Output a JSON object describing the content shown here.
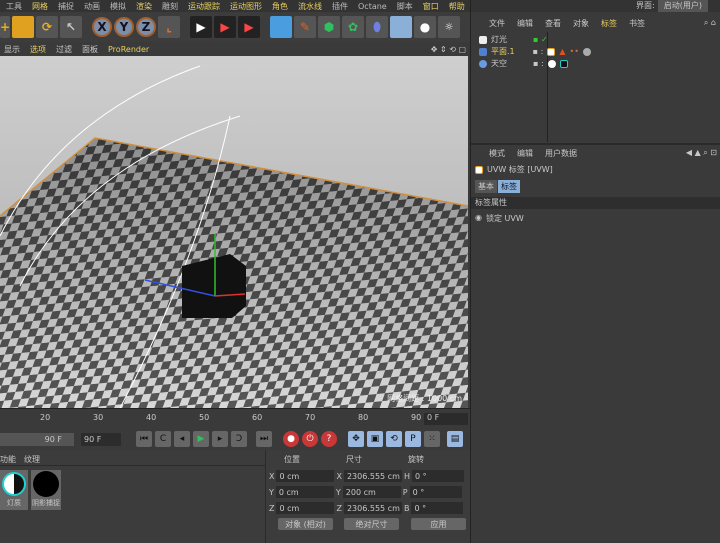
{
  "menu": [
    "工具",
    "网格",
    "捕捉",
    "动画",
    "模拟",
    "渲染",
    "雕刻",
    "运动跟踪",
    "运动图形",
    "角色",
    "流水线",
    "插件",
    "Octane",
    "脚本",
    "窗口",
    "帮助"
  ],
  "toolbar": {
    "x": "X",
    "y": "Y",
    "z": "Z"
  },
  "viewport_menu": [
    "显示",
    "选项",
    "过滤",
    "面板",
    "ProRender"
  ],
  "grid_spacing": "网格间距 : 1000 cm",
  "timeline": {
    "ticks": [
      "20",
      "30",
      "40",
      "50",
      "60",
      "70",
      "80",
      "90"
    ],
    "current_frame": "0 F",
    "range_end": "90 F",
    "end_field": "90 F"
  },
  "materials": {
    "tabs": [
      "功能",
      "纹理"
    ],
    "items": [
      "灯质",
      "阴影捕捉"
    ]
  },
  "coords": {
    "headers": [
      "位置",
      "尺寸",
      "旋转"
    ],
    "rows": [
      {
        "axis": "X",
        "pos": "0 cm",
        "size_axis": "X",
        "size": "2306.555 cm",
        "rot_axis": "H",
        "rot": "0 °"
      },
      {
        "axis": "Y",
        "pos": "0 cm",
        "size_axis": "Y",
        "size": "200 cm",
        "rot_axis": "P",
        "rot": "0 °"
      },
      {
        "axis": "Z",
        "pos": "0 cm",
        "size_axis": "Z",
        "size": "2306.555 cm",
        "rot_axis": "B",
        "rot": "0 °"
      }
    ],
    "mode": "对象 (相对)",
    "size_mode": "绝对尺寸",
    "apply": "应用"
  },
  "layout": {
    "label": "界面:",
    "value": "启动(用户)"
  },
  "object_manager": {
    "menu": [
      "文件",
      "编辑",
      "查看",
      "对象",
      "标签",
      "书签"
    ],
    "objects": [
      "灯光",
      "平面.1",
      "天空"
    ]
  },
  "attributes": {
    "menu": [
      "模式",
      "编辑",
      "用户数据"
    ],
    "title": "UVW 标签 [UVW]",
    "tabs": [
      "基本",
      "标签"
    ],
    "section": "标签属性",
    "option": "锁定 UVW"
  }
}
